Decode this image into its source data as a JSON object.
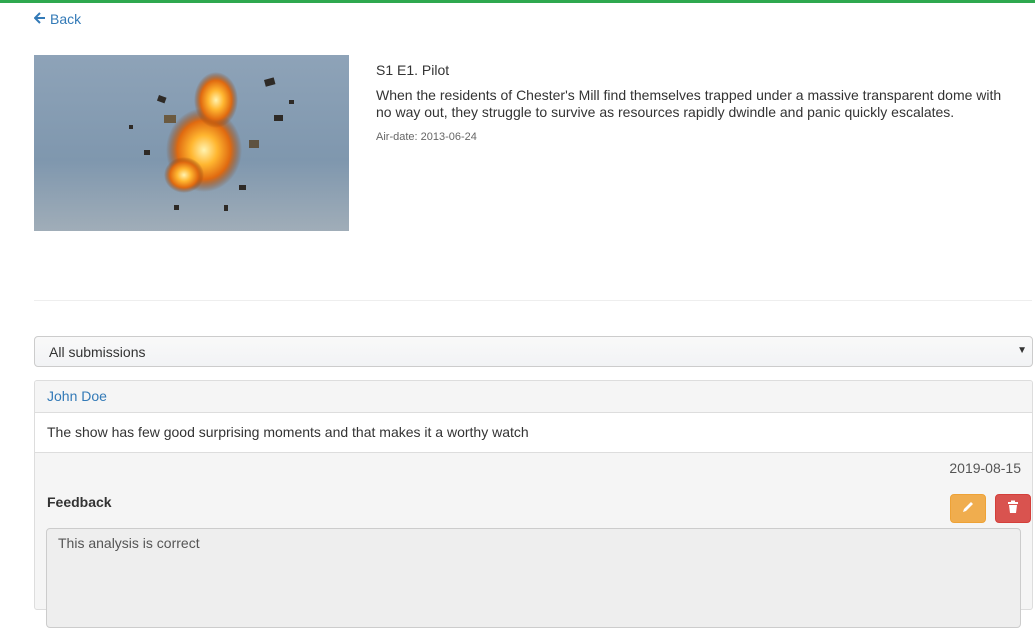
{
  "nav": {
    "back_label": "Back",
    "back_icon": "arrow-left-icon"
  },
  "episode": {
    "title": "S1 E1. Pilot",
    "description": "When the residents of Chester's Mill find themselves trapped under a massive transparent dome with no way out, they struggle to survive as resources rapidly dwindle and panic quickly escalates.",
    "air_date": "Air-date: 2013-06-24"
  },
  "filter": {
    "selected": "All submissions"
  },
  "submission": {
    "author": "John Doe",
    "text": "The show has few good surprising moments and that makes it a worthy watch",
    "date": "2019-08-15",
    "feedback_label": "Feedback",
    "feedback_value": "This analysis is correct"
  },
  "colors": {
    "topbar": "#2fa84f",
    "link": "#337ab7",
    "edit_button": "#f0ad4e",
    "delete_button": "#d9534f"
  },
  "icons": {
    "edit": "pencil-icon",
    "delete": "trash-icon"
  }
}
